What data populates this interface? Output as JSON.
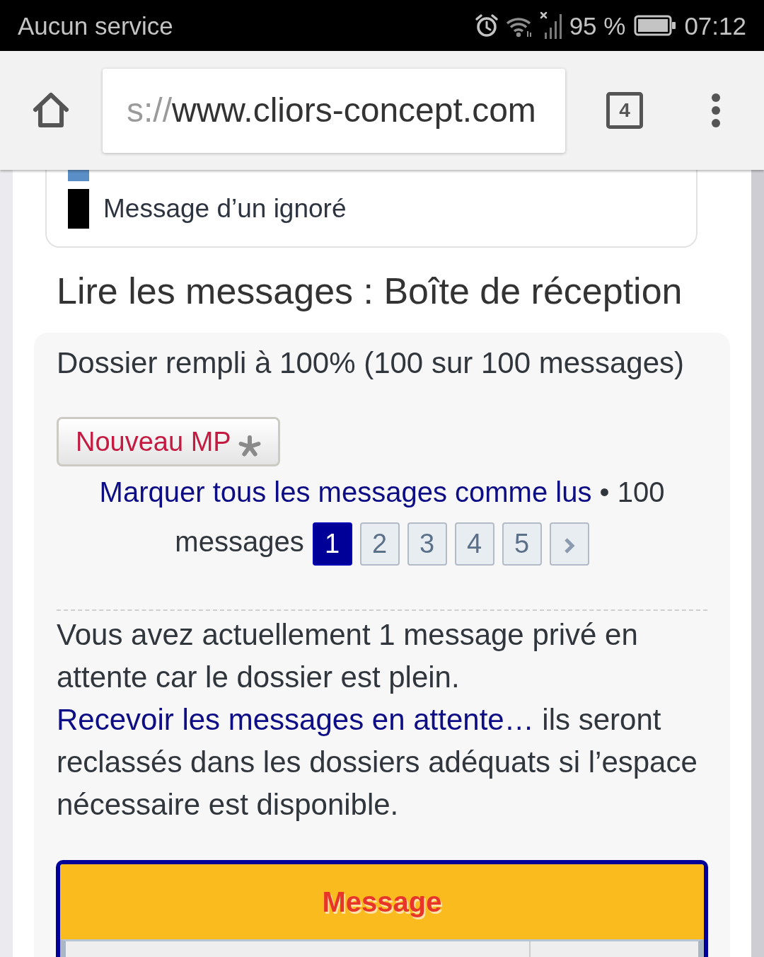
{
  "status_bar": {
    "carrier": "Aucun service",
    "battery": "95 %",
    "time": "07:12"
  },
  "browser": {
    "url_prefix": "s://",
    "url_host": "www.cliors-concept.com",
    "tab_count": "4"
  },
  "legend": {
    "items": [
      {
        "color": "#5a8ec6"
      },
      {
        "label": "Message d’un ignoré",
        "color": "#000000"
      }
    ]
  },
  "heading": "Lire les messages : Boîte de réception",
  "folder": {
    "fill_status": "Dossier rempli à 100% (100 sur 100 messages)",
    "new_message_button": "Nouveau MP",
    "mark_all_read_link": "Marquer tous les messages comme lus",
    "separator": "•",
    "message_count": "100 messages",
    "pages": [
      {
        "label": "1",
        "selected": true
      },
      {
        "label": "2",
        "selected": false
      },
      {
        "label": "3",
        "selected": false
      },
      {
        "label": "4",
        "selected": false
      },
      {
        "label": "5",
        "selected": false
      }
    ]
  },
  "notice": {
    "text": "Vous avez actuellement 1 message privé en attente car le dossier est plein.",
    "link": "Recevoir les messages en attente…",
    "followup": "ils seront reclassés dans les dossiers adéquats si l’espace nécessaire est disponible."
  },
  "table": {
    "header": "Message"
  }
}
